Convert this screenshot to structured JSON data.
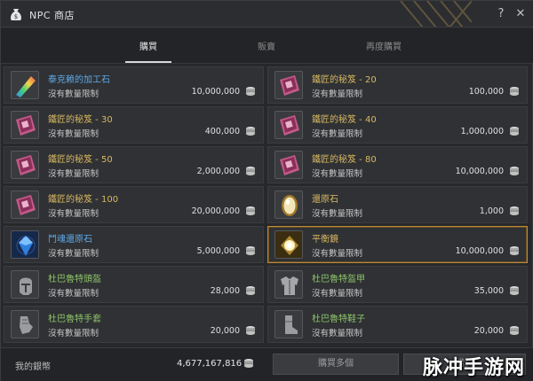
{
  "window": {
    "title": "NPC 商店"
  },
  "tabs": [
    {
      "label": "購買",
      "active": true
    },
    {
      "label": "販賣",
      "active": false
    },
    {
      "label": "再度購買",
      "active": false
    }
  ],
  "items": [
    {
      "name": "泰克赖的加工石",
      "name_color": "blue",
      "limit": "沒有數量限制",
      "price": "10,000,000",
      "icon": "rainbow-stone-icon"
    },
    {
      "name": "鐵匠的秘笈 - 20",
      "name_color": "gold",
      "limit": "沒有數量限制",
      "price": "100,000",
      "icon": "pink-book-icon"
    },
    {
      "name": "鐵匠的秘笈 - 30",
      "name_color": "gold",
      "limit": "沒有數量限制",
      "price": "400,000",
      "icon": "pink-book-icon"
    },
    {
      "name": "鐵匠的秘笈 - 40",
      "name_color": "gold",
      "limit": "沒有數量限制",
      "price": "1,000,000",
      "icon": "pink-book-icon"
    },
    {
      "name": "鐵匠的秘笈 - 50",
      "name_color": "gold",
      "limit": "沒有數量限制",
      "price": "2,000,000",
      "icon": "pink-book-icon"
    },
    {
      "name": "鐵匠的秘笈 - 80",
      "name_color": "gold",
      "limit": "沒有數量限制",
      "price": "10,000,000",
      "icon": "pink-book-icon"
    },
    {
      "name": "鐵匠的秘笈 - 100",
      "name_color": "gold",
      "limit": "沒有數量限制",
      "price": "20,000,000",
      "icon": "pink-book-icon"
    },
    {
      "name": "還原石",
      "name_color": "gold",
      "limit": "沒有數量限制",
      "price": "1,000",
      "icon": "gold-gem-icon"
    },
    {
      "name": "鬥魂還原石",
      "name_color": "blue",
      "limit": "沒有數量限制",
      "price": "5,000,000",
      "icon": "blue-crystal-icon"
    },
    {
      "name": "平衡鏡",
      "name_color": "gold",
      "limit": "沒有數量限制",
      "price": "10,000,000",
      "icon": "glow-mirror-icon",
      "selected": true
    },
    {
      "name": "杜巴魯特頭盔",
      "name_color": "green",
      "limit": "沒有數量限制",
      "price": "28,000",
      "icon": "helmet-icon"
    },
    {
      "name": "杜巴魯特盔甲",
      "name_color": "green",
      "limit": "沒有數量限制",
      "price": "35,000",
      "icon": "armor-icon"
    },
    {
      "name": "杜巴魯特手套",
      "name_color": "green",
      "limit": "沒有數量限制",
      "price": "20,000",
      "icon": "gauntlet-icon"
    },
    {
      "name": "杜巴魯特鞋子",
      "name_color": "green",
      "limit": "沒有數量限制",
      "price": "20,000",
      "icon": "boots-icon"
    }
  ],
  "footer": {
    "wallet_label": "我的銀幣",
    "wallet_value": "4,677,167,816",
    "buy_multiple": "購買多個",
    "buy": "購買"
  },
  "watermark": "脉冲手游网",
  "colors": {
    "accent_gold": "#d9b863",
    "accent_blue": "#5fa9e8",
    "accent_green": "#8ec46a",
    "selected_border": "#b98a3b"
  }
}
